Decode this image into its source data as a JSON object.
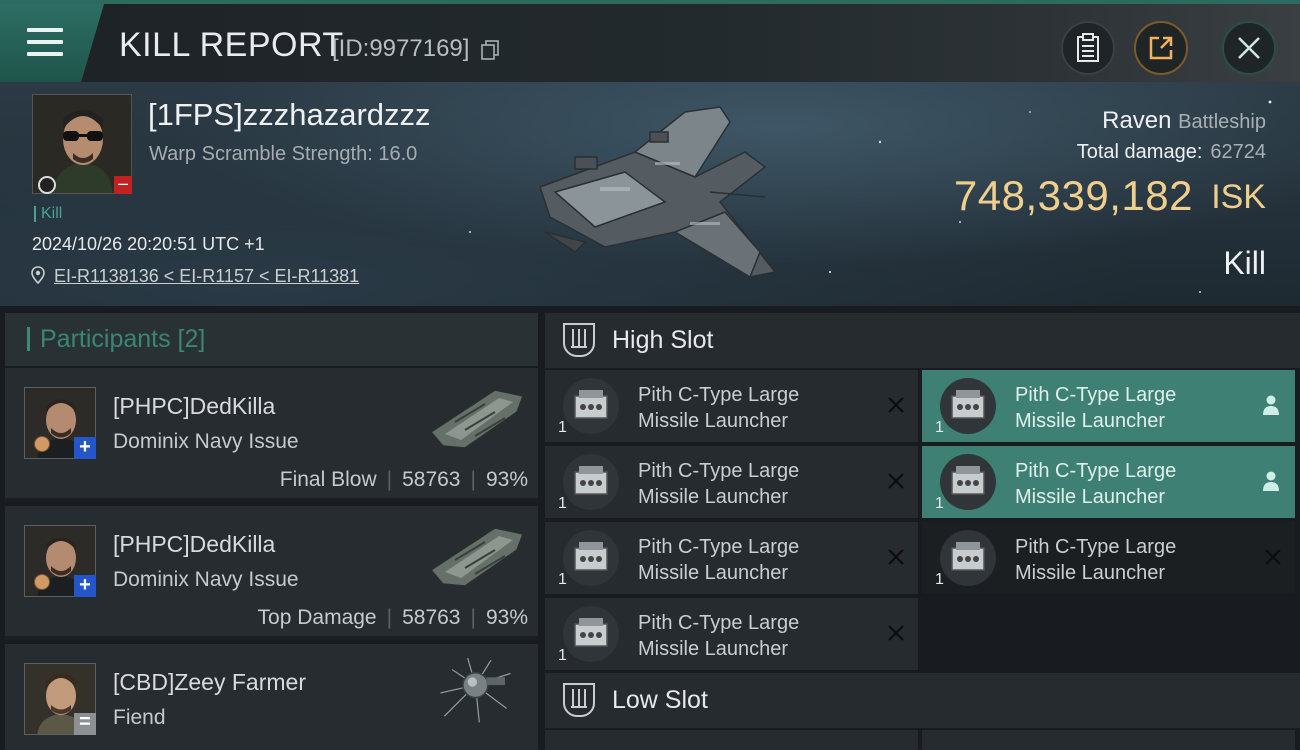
{
  "header": {
    "title": "KILL REPORT",
    "report_id": "[ID:9977169]"
  },
  "victim": {
    "name": "[1FPS]zzzhazardzzz",
    "warp_scramble": "Warp Scramble Strength: 16.0",
    "kill_tag": "Kill",
    "datetime": "2024/10/26 20:20:51 UTC +1",
    "location": "EI-R1138136 < EI-R1157 < EI-R11381",
    "ship_name": "Raven",
    "ship_class": "Battleship",
    "total_damage_label": "Total damage:",
    "total_damage_value": "62724",
    "isk_value": "748,339,182",
    "isk_unit": "ISK",
    "result": "Kill"
  },
  "participants": {
    "header": "Participants [2]",
    "items": [
      {
        "name": "[PHPC]DedKilla",
        "ship": "Dominix Navy Issue",
        "role": "Final Blow",
        "damage": "58763",
        "percent": "93%"
      },
      {
        "name": "[PHPC]DedKilla",
        "ship": "Dominix Navy Issue",
        "role": "Top Damage",
        "damage": "58763",
        "percent": "93%"
      },
      {
        "name": "[CBD]Zeey Farmer",
        "ship": "Fiend"
      }
    ]
  },
  "fitting": {
    "high_slot_label": "High Slot",
    "low_slot_label": "Low Slot",
    "high_modules": [
      {
        "line1": "Pith C-Type Large",
        "line2": "Missile Launcher",
        "qty": "1",
        "state": "destroyed"
      },
      {
        "line1": "Pith C-Type Large",
        "line2": "Missile Launcher",
        "qty": "1",
        "state": "dropped"
      },
      {
        "line1": "Pith C-Type Large",
        "line2": "Missile Launcher",
        "qty": "1",
        "state": "destroyed"
      },
      {
        "line1": "Pith C-Type Large",
        "line2": "Missile Launcher",
        "qty": "1",
        "state": "dropped"
      },
      {
        "line1": "Pith C-Type Large",
        "line2": "Missile Launcher",
        "qty": "1",
        "state": "destroyed"
      },
      {
        "line1": "Pith C-Type Large",
        "line2": "Missile Launcher",
        "qty": "1",
        "state": "destroyed"
      },
      {
        "line1": "Pith C-Type Large",
        "line2": "Missile Launcher",
        "qty": "1",
        "state": "destroyed"
      }
    ]
  },
  "colors": {
    "accent_teal": "#3e8174",
    "isk_gold": "#f0cf8e",
    "minus_red": "#c32121",
    "plus_blue": "#2456c9"
  },
  "icons": [
    "menu-icon",
    "copy-icon",
    "clipboard-icon",
    "share-icon",
    "close-icon",
    "location-pin-icon",
    "high-slot-icon",
    "low-slot-icon",
    "destroyed-x-icon",
    "person-icon"
  ]
}
